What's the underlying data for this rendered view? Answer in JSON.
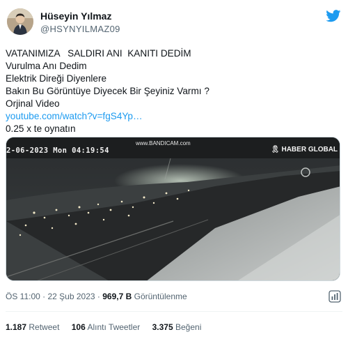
{
  "author": {
    "name": "Hüseyin Yılmaz",
    "handle": "@HSYNYILMAZ09",
    "avatar_icon": "user-avatar"
  },
  "tweet": {
    "lines": [
      "VATANIMIZA   SALDIRI ANI  KANITI DEDİM",
      "Vurulma Anı Dedim",
      "Elektrik Direği Diyenlere",
      "Bakın Bu Görüntüye Diyecek Bir Şeyiniz Varmı ?",
      "Orjinal Video"
    ],
    "link": "youtube.com/watch?v=fgS4Yp…",
    "last_line": "0.25 x te oynatın"
  },
  "media": {
    "timestamp": "2-06-2023 Mon 04:19:54",
    "watermark": "www.BANDICAM.com",
    "channel": "HABER GLOBAL",
    "channel_icon": "black-ribbon-icon"
  },
  "meta": {
    "time": "ÖS 11:00",
    "separator": "·",
    "date": "22 Şub 2023",
    "views": "969,7 B",
    "views_label": "Görüntülenme"
  },
  "stats": {
    "retweets": "1.187",
    "retweets_label": "Retweet",
    "quotes": "106",
    "quotes_label": "Alıntı Tweetler",
    "likes": "3.375",
    "likes_label": "Beğeni"
  },
  "colors": {
    "link": "#1d9bf0",
    "secondary_text": "#536471",
    "primary_text": "#0f1419",
    "twitter_brand": "#1d9bf0"
  }
}
